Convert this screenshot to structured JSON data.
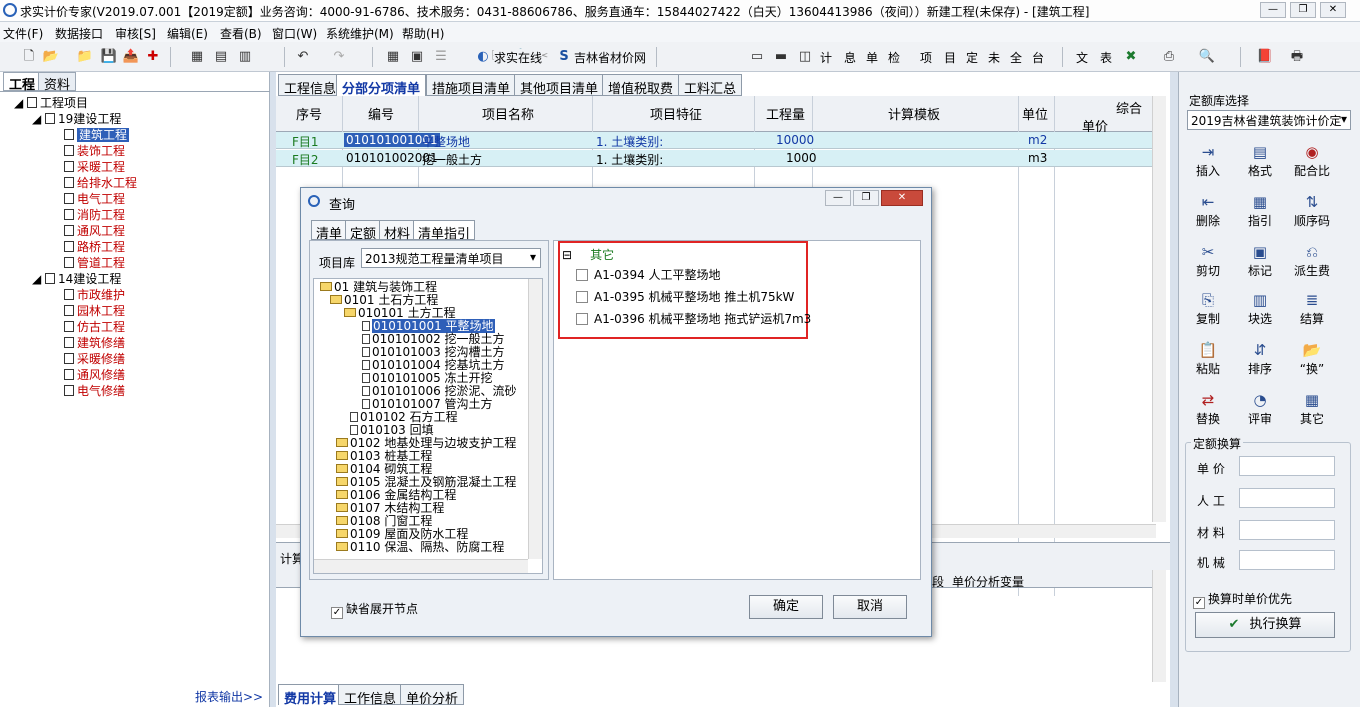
{
  "window": {
    "title": "求实计价专家(V2019.07.001【2019定额】业务咨询：4000-91-6786、技术服务：0431-88606786、服务直通车：15844027422（白天）13604413986（夜间））新建工程(未保存) - [建筑工程]",
    "min": "—",
    "max": "❐",
    "close": "✕"
  },
  "menu": [
    "文件(F)",
    "数据接口",
    "审核[S]",
    "编辑(E)",
    "查看(B)",
    "窗口(W)",
    "系统维护(M)",
    "帮助(H)"
  ],
  "toolbar": {
    "online": "求实在线",
    "price_net": "吉林省材价网",
    "text_buttons": [
      "计",
      "息",
      "单",
      "检",
      "项",
      "目",
      "定",
      "未",
      "全",
      "台",
      "文",
      "表"
    ]
  },
  "left": {
    "tabs": [
      "工程",
      "资料"
    ],
    "root": "工程项目",
    "groups": [
      {
        "name": "19建设工程",
        "items": [
          "建筑工程",
          "装饰工程",
          "采暖工程",
          "给排水工程",
          "电气工程",
          "消防工程",
          "通风工程",
          "路桥工程",
          "管道工程"
        ]
      },
      {
        "name": "14建设工程",
        "items": [
          "市政维护",
          "园林工程",
          "仿古工程",
          "建筑修缮",
          "采暖修缮",
          "通风修缮",
          "电气修缮"
        ]
      }
    ],
    "report": "报表输出>>"
  },
  "center": {
    "tabs": [
      "工程信息",
      "分部分项清单",
      "措施项目清单",
      "其他项目清单",
      "增值税取费",
      "工料汇总"
    ],
    "headers": [
      "序号",
      "编号",
      "项目名称",
      "项目特征",
      "工程量",
      "计算模板",
      "单位",
      "综合",
      "单价"
    ],
    "rows": [
      {
        "seq": "F目1",
        "code": "010101001001",
        "name": "平整场地",
        "feature": "1. 土壤类别:",
        "qty": "10000",
        "unit": "m2"
      },
      {
        "seq": "F目2",
        "code": "010101002001",
        "name": "挖一般土方",
        "feature": "1. 土壤类别:",
        "qty": "1000",
        "unit": "m3"
      }
    ],
    "lower_label": "计算",
    "lower_headers": [
      "段",
      "单价分析变量"
    ],
    "bottom_tabs": [
      "费用计算",
      "工作信息",
      "单价分析"
    ]
  },
  "right": {
    "lib_label": "定额库选择",
    "lib_value": "2019吉林省建筑装饰计价定",
    "buttons": [
      "插入",
      "格式",
      "配合比",
      "删除",
      "指引",
      "顺序码",
      "剪切",
      "标记",
      "派生费",
      "复制",
      "块选",
      "结算",
      "粘贴",
      "排序",
      "“换”",
      "替换",
      "评审",
      "其它"
    ],
    "calc_title": "定额换算",
    "fields": [
      "单 价",
      "人 工",
      "材 料",
      "机 械"
    ],
    "priority": "换算时单价优先",
    "execute": "执行换算"
  },
  "dialog": {
    "title": "查询",
    "tabs": [
      "清单",
      "定额",
      "材料",
      "清单指引"
    ],
    "lib_label": "项目库",
    "lib_value": "2013规范工程量清单项目",
    "tree": [
      "01 建筑与装饰工程",
      "0101 土石方工程",
      "010101 土方工程",
      "010101001 平整场地",
      "010101002 挖一般土方",
      "010101003 挖沟槽土方",
      "010101004 挖基坑土方",
      "010101005 冻土开挖",
      "010101006 挖淤泥、流砂",
      "010101007 管沟土方",
      "010102 石方工程",
      "010103 回填",
      "0102 地基处理与边坡支护工程",
      "0103 桩基工程",
      "0104 砌筑工程",
      "0105 混凝土及钢筋混凝土工程",
      "0106 金属结构工程",
      "0107 木结构工程",
      "0108 门窗工程",
      "0109 屋面及防水工程",
      "0110 保温、隔热、防腐工程"
    ],
    "right_group": "其它",
    "right_items": [
      "A1-0394 人工平整场地",
      "A1-0395 机械平整场地 推土机75kW",
      "A1-0396 机械平整场地 拖式铲运机7m3"
    ],
    "expand_default": "缺省展开节点",
    "ok": "确定",
    "cancel": "取消",
    "min": "—",
    "max": "❐",
    "close": "✕"
  }
}
